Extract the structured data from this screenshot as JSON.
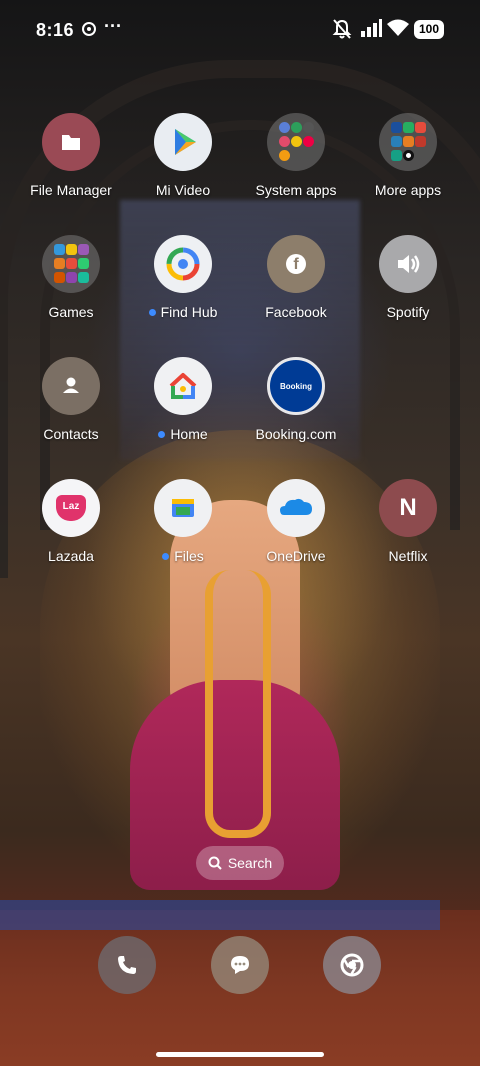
{
  "status": {
    "time": "8:16",
    "more": "···",
    "battery": "100"
  },
  "apps": [
    {
      "label": "File Manager",
      "icon": "folder-icon",
      "dot": false
    },
    {
      "label": "Mi Video",
      "icon": "play-icon",
      "dot": false
    },
    {
      "label": "System apps",
      "icon": "folder-grid-icon",
      "dot": false
    },
    {
      "label": "More apps",
      "icon": "folder-grid-icon",
      "dot": false
    },
    {
      "label": "Games",
      "icon": "folder-grid-icon",
      "dot": false
    },
    {
      "label": "Find Hub",
      "icon": "find-hub-icon",
      "dot": true
    },
    {
      "label": "Facebook",
      "icon": "facebook-icon",
      "dot": false
    },
    {
      "label": "Spotify",
      "icon": "speaker-icon",
      "dot": false
    },
    {
      "label": "Contacts",
      "icon": "person-icon",
      "dot": false
    },
    {
      "label": "Home",
      "icon": "google-home-icon",
      "dot": true
    },
    {
      "label": "Booking.com",
      "icon": "booking-icon",
      "dot": false
    },
    {
      "label": "Lazada",
      "icon": "lazada-icon",
      "dot": false
    },
    {
      "label": "Files",
      "icon": "files-icon",
      "dot": true
    },
    {
      "label": "OneDrive",
      "icon": "cloud-icon",
      "dot": false
    },
    {
      "label": "Netflix",
      "icon": "netflix-icon",
      "dot": false
    }
  ],
  "icon_text": {
    "booking": "Booking",
    "lazada": "Laz",
    "netflix": "N",
    "facebook": "f"
  },
  "search": {
    "label": "Search"
  },
  "dock": [
    {
      "name": "phone",
      "icon": "phone-icon"
    },
    {
      "name": "messages",
      "icon": "message-icon"
    },
    {
      "name": "chrome",
      "icon": "chrome-icon"
    }
  ],
  "colors": {
    "badge_dot": "#3d8bff",
    "booking_blue": "#003b95",
    "netflix_red": "#b1060f",
    "lazada_pink": "#e0336b"
  }
}
